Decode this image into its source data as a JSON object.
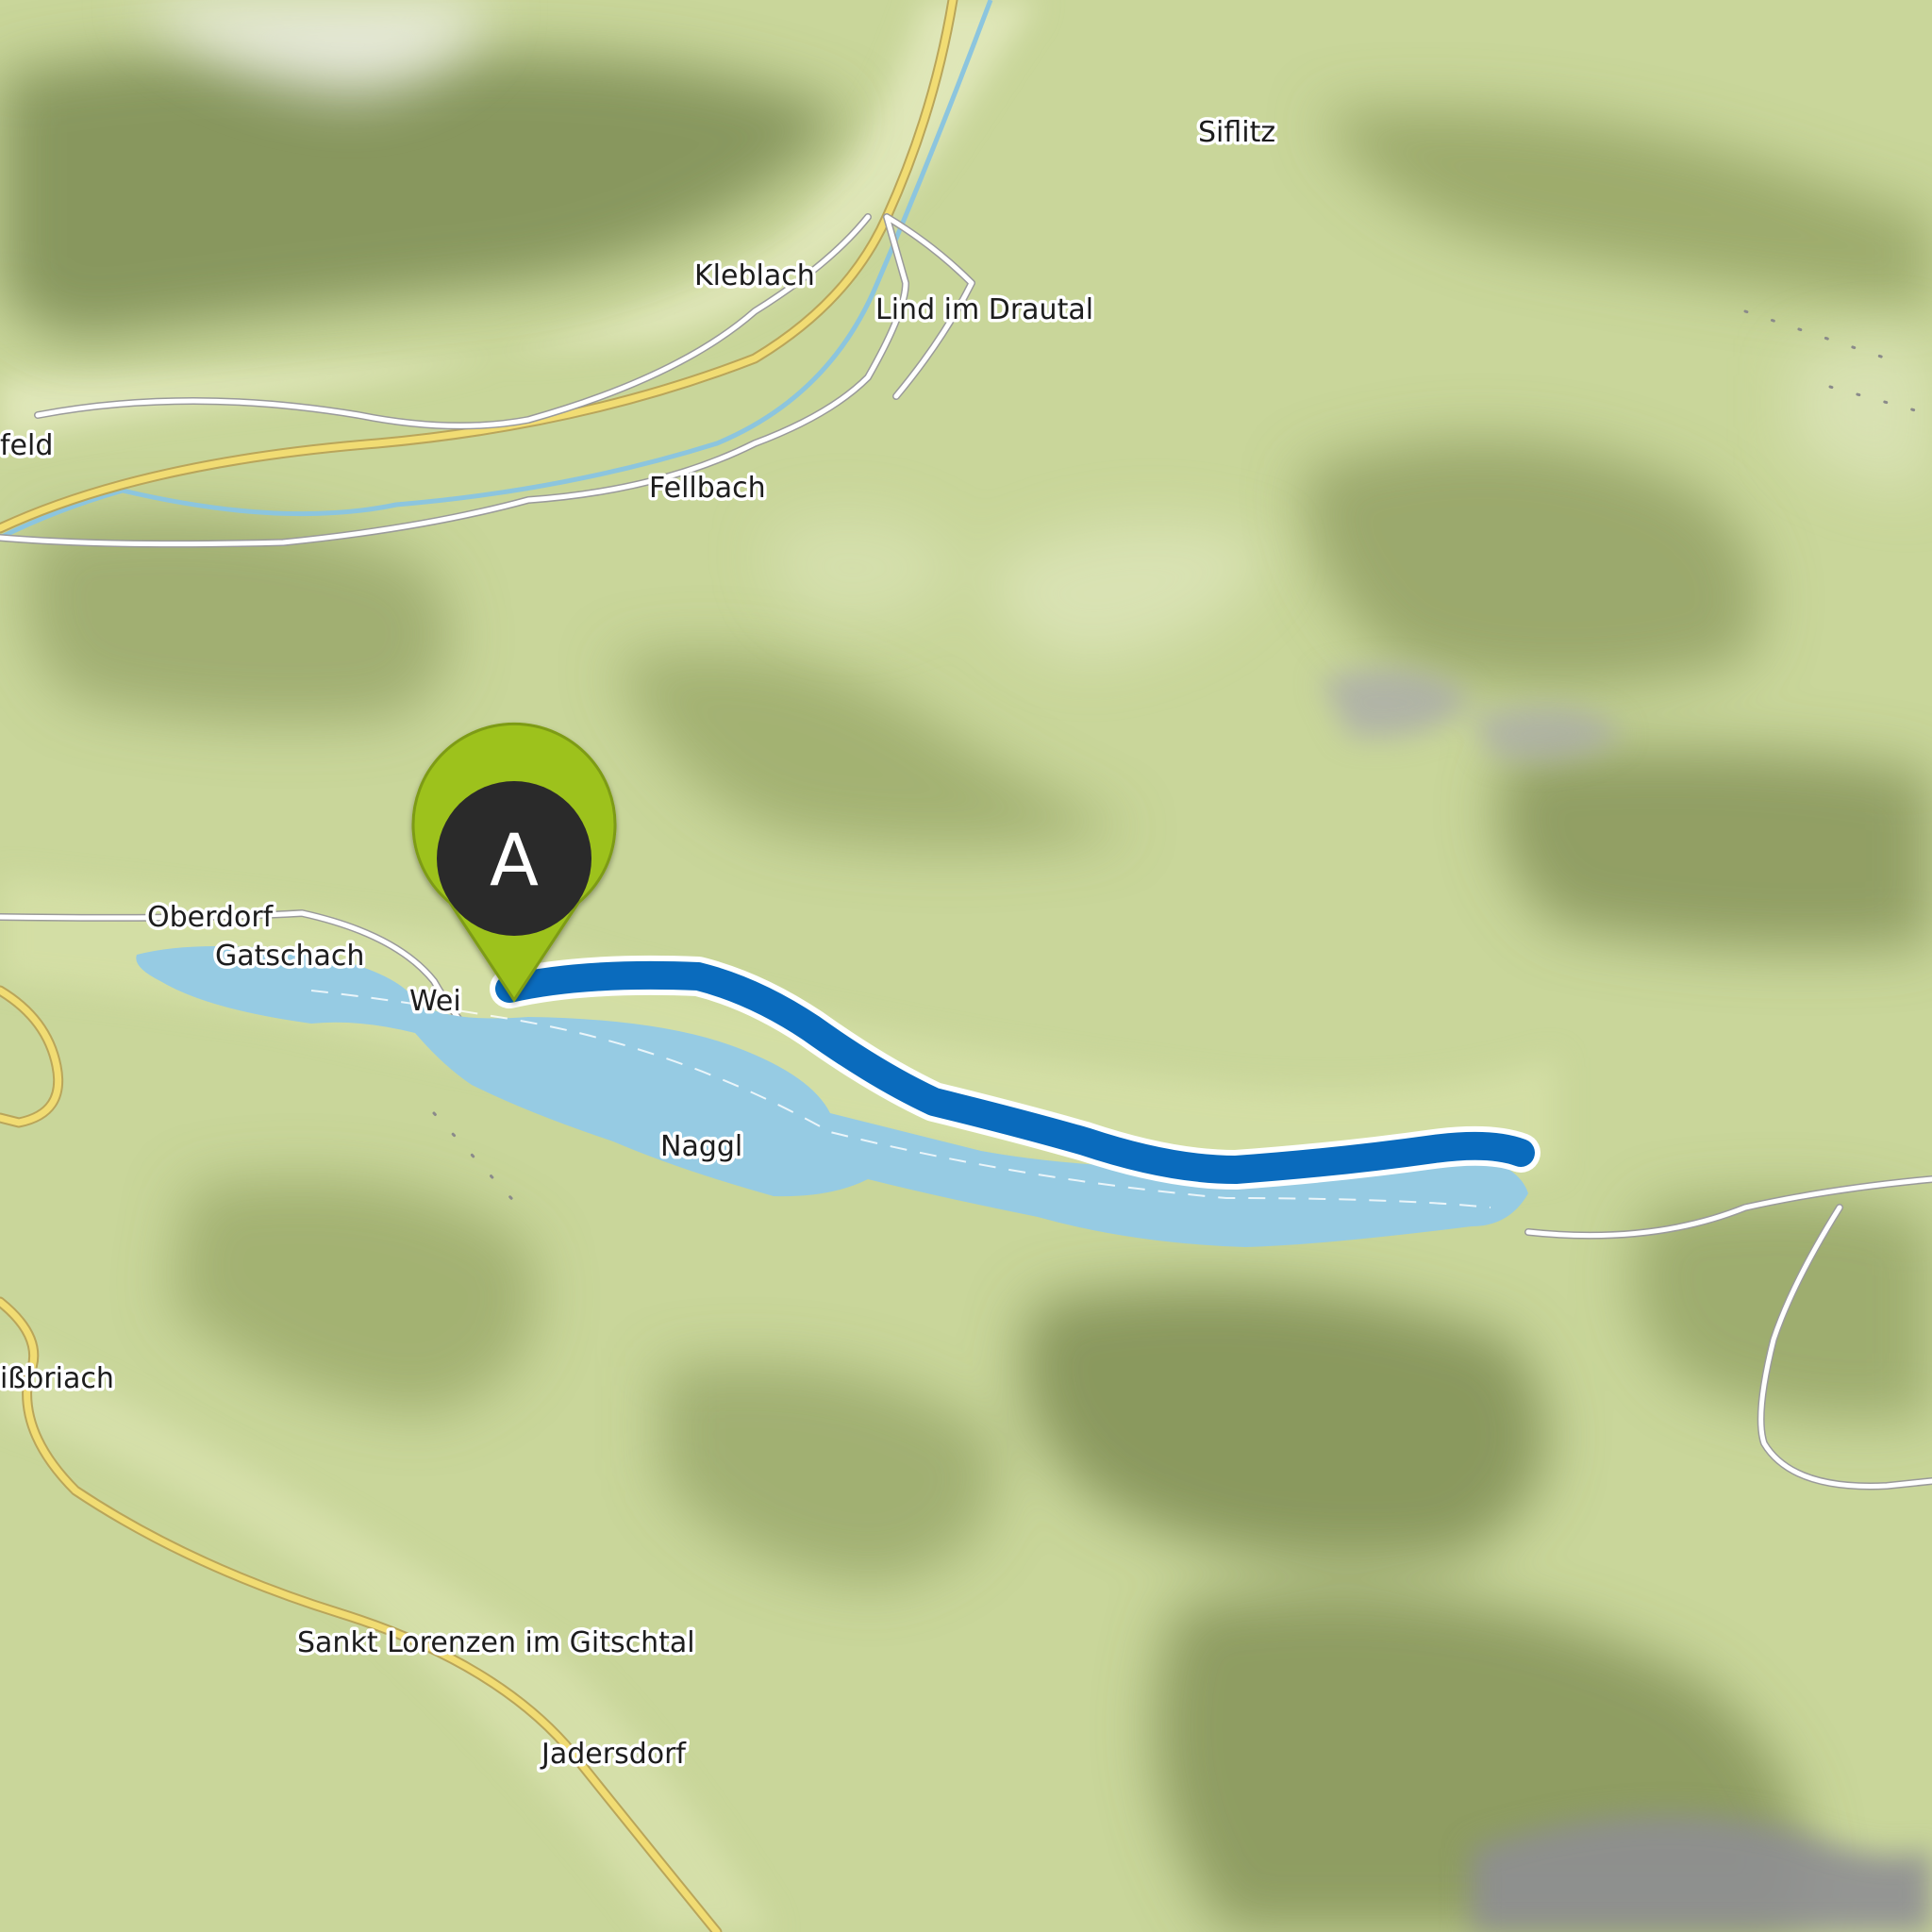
{
  "map": {
    "colors": {
      "terrain": "#c9d69a",
      "lake": "#96cbe3",
      "route": "#0a6bbd",
      "marker_pin": "#9dc21a",
      "marker_center": "#2b2b2b",
      "road_major": "#f1dc73",
      "river": "#8cc5de",
      "road_minor": "#ffffff"
    },
    "places": {
      "siflitz": "Siflitz",
      "kleblach": "Kleblach",
      "lind_im_drautal": "Lind im Drautal",
      "feld": "feld",
      "fellbach": "Fellbach",
      "oberdorf": "Oberdorf",
      "gatschach": "Gatschach",
      "wei": "Wei",
      "naggl": "Naggl",
      "weissbriach": "ißbriach",
      "sankt_lorenzen": "Sankt Lorenzen im Gitschtal",
      "jadersdorf": "Jadersdorf"
    },
    "route_marker": {
      "letter": "A",
      "icon": "map-pin-icon"
    }
  }
}
